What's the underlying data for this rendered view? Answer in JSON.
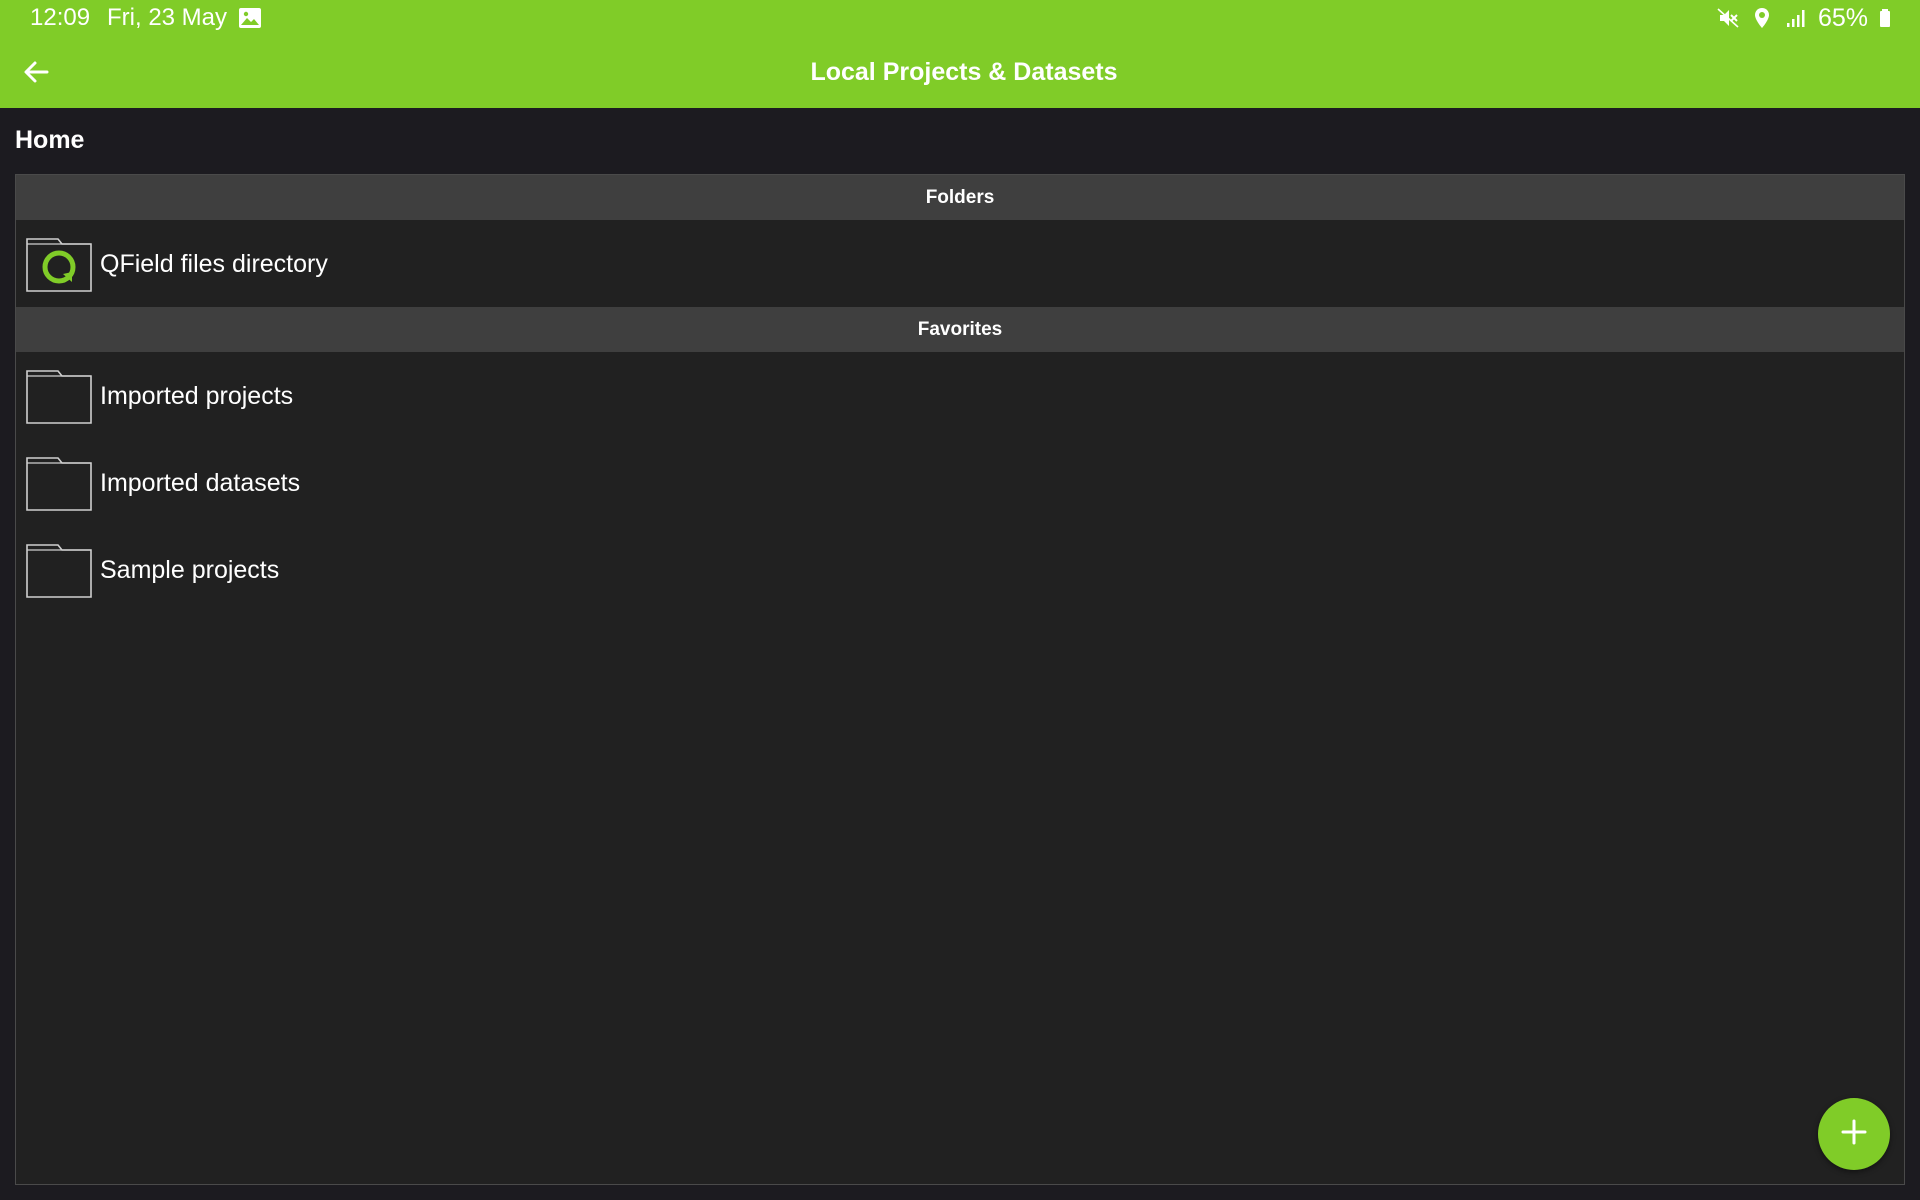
{
  "status_bar": {
    "time": "12:09",
    "date": "Fri, 23 May",
    "battery": "65%",
    "icons": [
      "image-icon",
      "mute-icon",
      "location-icon",
      "signal-icon",
      "battery-icon"
    ]
  },
  "app_bar": {
    "title": "Local Projects & Datasets",
    "back_icon": "arrow-back-icon",
    "color": "#80cc28"
  },
  "breadcrumb": "Home",
  "sections": [
    {
      "header": "Folders",
      "items": [
        {
          "label": "QField files directory",
          "icon": "qfield-folder-icon"
        }
      ]
    },
    {
      "header": "Favorites",
      "items": [
        {
          "label": "Imported projects",
          "icon": "folder-icon"
        },
        {
          "label": "Imported datasets",
          "icon": "folder-icon"
        },
        {
          "label": "Sample projects",
          "icon": "folder-icon"
        }
      ]
    }
  ],
  "fab": {
    "icon": "plus-icon"
  }
}
